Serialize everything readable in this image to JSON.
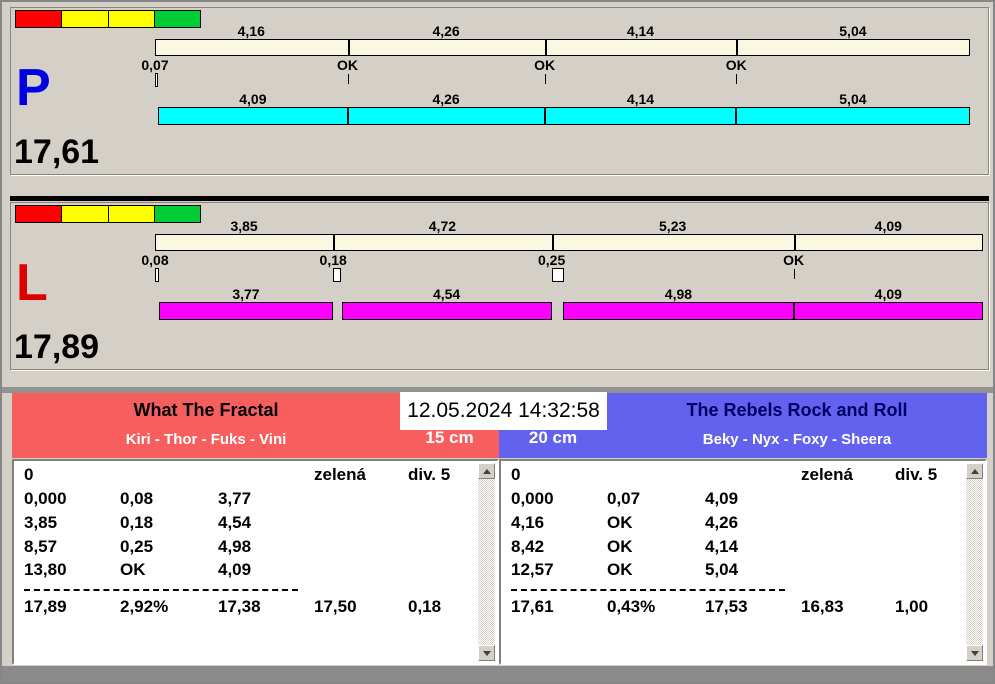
{
  "colors": {
    "background": "#D4D0C8",
    "split_bar": "#FBF8E1",
    "divider_black": "#000000",
    "pre_strip_gray": "#929292",
    "bottom_strip_gray": "#8A8A8A",
    "gap_box": "#FFFFFF"
  },
  "datetime": "12.05.2024 14:32:58",
  "lanes": [
    {
      "letter": "P",
      "letter_color": "#0000E0",
      "total_label": "17,61",
      "total_seconds": 17.61,
      "run_color": "#00FFFF",
      "lights": [
        "#FF0000",
        "#FFFF00",
        "#FFFF00",
        "#00CC33"
      ],
      "split_labels": [
        "4,16",
        "4,26",
        "4,14",
        "5,04"
      ],
      "split_values": [
        4.16,
        4.26,
        4.14,
        5.04
      ],
      "checks": [
        {
          "label": "0,07",
          "gap": 0.07
        },
        {
          "label": "OK"
        },
        {
          "label": "OK"
        },
        {
          "label": "OK"
        }
      ],
      "run_labels": [
        "4,09",
        "4,26",
        "4,14",
        "5,04"
      ],
      "run_values": [
        4.09,
        4.26,
        4.14,
        5.04
      ]
    },
    {
      "letter": "L",
      "letter_color": "#DD0000",
      "total_label": "17,89",
      "total_seconds": 17.89,
      "run_color": "#FF00FF",
      "lights": [
        "#FF0000",
        "#FFFF00",
        "#FFFF00",
        "#00CC33"
      ],
      "split_labels": [
        "3,85",
        "4,72",
        "5,23",
        "4,09"
      ],
      "split_values": [
        3.85,
        4.72,
        5.23,
        4.09
      ],
      "checks": [
        {
          "label": "0,08",
          "gap": 0.08
        },
        {
          "label": "0,18",
          "gap": 0.18
        },
        {
          "label": "0,25",
          "gap": 0.25
        },
        {
          "label": "OK"
        }
      ],
      "run_labels": [
        "3,77",
        "4,54",
        "4,98",
        "4,09"
      ],
      "run_values": [
        3.77,
        4.54,
        4.98,
        4.09
      ]
    }
  ],
  "teams": [
    {
      "name": "What The Fractal",
      "dogs": "Kiri - Thor - Fuks - Vini",
      "height": "15 cm",
      "header_bg": "#F75F5F",
      "name_color": "#000000",
      "table": {
        "header_cells": [
          "0",
          "zelená",
          "div. 5"
        ],
        "rows": [
          [
            "0,000",
            "0,08",
            "3,77"
          ],
          [
            "3,85",
            "0,18",
            "4,54"
          ],
          [
            "8,57",
            "0,25",
            "4,98"
          ],
          [
            "13,80",
            "OK",
            "4,09"
          ]
        ],
        "summary": [
          "17,89",
          "2,92%",
          "17,38",
          "17,50",
          "0,18"
        ]
      }
    },
    {
      "name": "The Rebels Rock and Roll",
      "dogs": "Beky - Nyx - Foxy - Sheera",
      "height": "20 cm",
      "header_bg": "#6262EE",
      "name_color": "#000066",
      "table": {
        "header_cells": [
          "0",
          "zelená",
          "div. 5"
        ],
        "rows": [
          [
            "0,000",
            "0,07",
            "4,09"
          ],
          [
            "4,16",
            "OK",
            "4,26"
          ],
          [
            "8,42",
            "OK",
            "4,14"
          ],
          [
            "12,57",
            "OK",
            "5,04"
          ]
        ],
        "summary": [
          "17,61",
          "0,43%",
          "17,53",
          "16,83",
          "1,00"
        ]
      }
    }
  ]
}
